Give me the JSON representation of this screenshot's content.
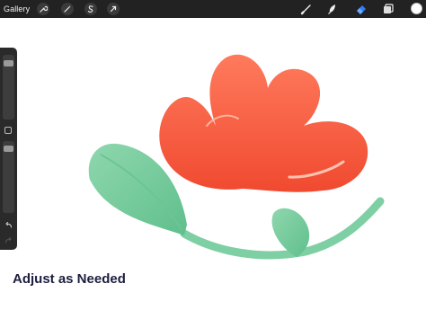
{
  "toolbar": {
    "gallery_label": "Gallery",
    "left_tools": [
      {
        "icon": "wrench-icon"
      },
      {
        "icon": "magic-wand-icon"
      },
      {
        "icon": "selection-icon"
      },
      {
        "icon": "transform-arrow-icon"
      }
    ],
    "right_tools": [
      {
        "icon": "brush-icon"
      },
      {
        "icon": "smudge-icon"
      },
      {
        "icon": "eraser-icon",
        "active": true
      },
      {
        "icon": "layers-icon"
      }
    ],
    "active_color": "#ffffff",
    "accent_color": "#2f7ff5"
  },
  "sidebar": {
    "size_slider_level": 0.92,
    "opacity_slider_level": 0.95,
    "modify_button_icon": "square-icon",
    "undo_icon": "undo-icon",
    "redo_icon": "redo-icon"
  },
  "canvas": {
    "illustration": "flower-illustration",
    "petal_color": "#ff6a4a",
    "leaf_color": "#7fcfa4"
  },
  "caption": "Adjust as Needed"
}
